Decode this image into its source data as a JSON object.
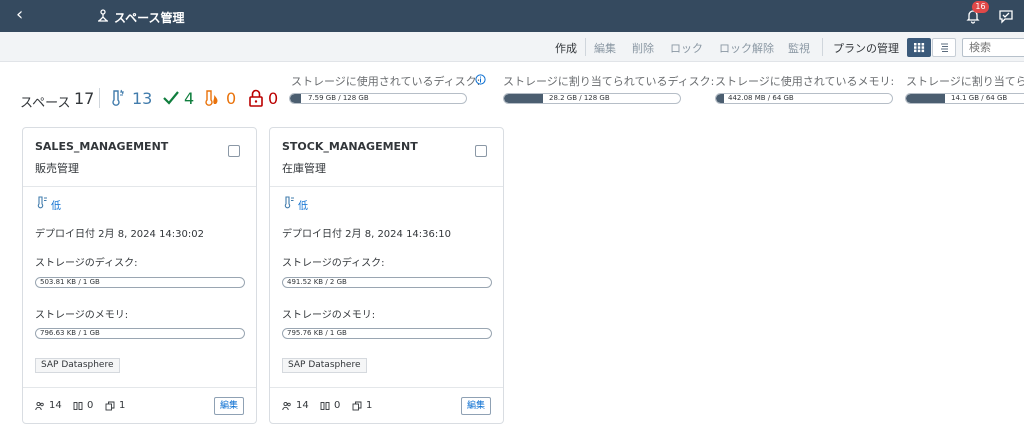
{
  "shell": {
    "title": "スペース管理",
    "notification_count": "16"
  },
  "toolbar": {
    "create": "作成",
    "edit": "編集",
    "delete": "削除",
    "lock": "ロック",
    "unlock": "ロック解除",
    "monitor": "監視",
    "plan": "プランの管理",
    "search_placeholder": "検索"
  },
  "summary": {
    "spaces_label": "スペース",
    "spaces_count": "17",
    "low_count": "13",
    "ok_count": "4",
    "hot_count": "0",
    "locked_count": "0",
    "colors": {
      "low": "#427cac",
      "ok": "#107e3e",
      "hot": "#e9730c",
      "locked": "#bb0000"
    },
    "meters": [
      {
        "label": "ストレージに使用されているディスク:",
        "value": "7.59 GB / 128 GB",
        "fraction": 0.06
      },
      {
        "label": "ストレージに割り当てられているディスク:",
        "value": "28.2 GB / 128 GB",
        "fraction": 0.22
      },
      {
        "label": "ストレージに使用されているメモリ:",
        "value": "442.08 MB / 64 GB",
        "fraction": 0.03
      },
      {
        "label": "ストレージに割り当てられ",
        "value": "14.1 GB / 64 GB",
        "fraction": 0.22
      }
    ]
  },
  "cards": [
    {
      "name": "SALES_MANAGEMENT",
      "subtitle": "販売管理",
      "priority": "低",
      "deploy": "デプロイ日付 2月 8, 2024 14:30:02",
      "disk_label": "ストレージのディスク:",
      "disk_value": "503.81 KB / 1 GB",
      "mem_label": "ストレージのメモリ:",
      "mem_value": "796.63 KB / 1 GB",
      "tag": "SAP Datasphere",
      "users": "14",
      "connections": "0",
      "copies": "1",
      "edit": "編集"
    },
    {
      "name": "STOCK_MANAGEMENT",
      "subtitle": "在庫管理",
      "priority": "低",
      "deploy": "デプロイ日付 2月 8, 2024 14:36:10",
      "disk_label": "ストレージのディスク:",
      "disk_value": "491.52 KB / 2 GB",
      "mem_label": "ストレージのメモリ:",
      "mem_value": "795.76 KB / 1 GB",
      "tag": "SAP Datasphere",
      "users": "14",
      "connections": "0",
      "copies": "1",
      "edit": "編集"
    }
  ]
}
